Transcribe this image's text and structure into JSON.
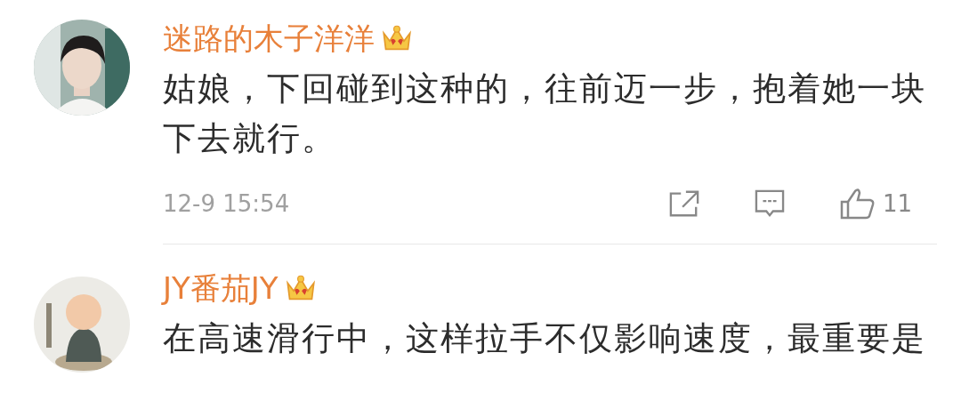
{
  "comments": [
    {
      "user": "迷路的木子洋洋",
      "vip": true,
      "text": "姑娘，下回碰到这种的，往前迈一步，抱着她一块下去就行。",
      "time": "12-9 15:54",
      "likes": "11"
    },
    {
      "user": "JY番茄JY",
      "vip": true,
      "text": "在高速滑行中，这样拉手不仅影响速度，最重要是"
    }
  ]
}
